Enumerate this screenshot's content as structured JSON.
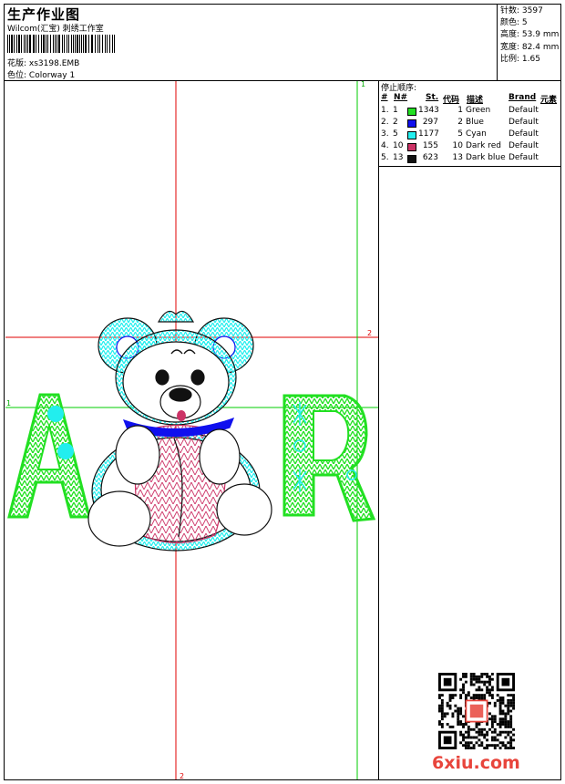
{
  "header": {
    "title": "生产作业图",
    "company": "Wilcom(汇宝) 刺绣工作室",
    "design_label": "花版:",
    "design_file": "xs3198.EMB",
    "colorway_label": "色位:",
    "colorway_name": "Colorway 1"
  },
  "stats": {
    "stitches_label": "针数:",
    "stitches": "3597",
    "colors_label": "颜色:",
    "colors": "5",
    "height_label": "高度:",
    "height": "53.9 mm",
    "width_label": "宽度:",
    "width": "82.4 mm",
    "scale_label": "比例:",
    "scale": "1.65"
  },
  "stop_sequence": {
    "title": "停止顺序:",
    "columns": [
      "#",
      "N#",
      "St.",
      "代码",
      "描述",
      "Brand",
      "元素"
    ],
    "rows": [
      {
        "num": "1.",
        "n": "1",
        "color": "#22e022",
        "stitches": "1343",
        "code": "1",
        "desc": "Green",
        "brand": "Default"
      },
      {
        "num": "2.",
        "n": "2",
        "color": "#1010ee",
        "stitches": "297",
        "code": "2",
        "desc": "Blue",
        "brand": "Default"
      },
      {
        "num": "3.",
        "n": "5",
        "color": "#22eeee",
        "stitches": "1177",
        "code": "5",
        "desc": "Cyan",
        "brand": "Default"
      },
      {
        "num": "4.",
        "n": "10",
        "color": "#cc3366",
        "stitches": "155",
        "code": "10",
        "desc": "Dark red",
        "brand": "Default"
      },
      {
        "num": "5.",
        "n": "13",
        "color": "#111111",
        "stitches": "623",
        "code": "13",
        "desc": "Dark blue",
        "brand": "Default"
      }
    ]
  },
  "guides": {
    "v_green_top": "1",
    "h_red_right": "2",
    "h_green_left": "1",
    "v_red_bottom": "2"
  },
  "watermark": "6xiu.com",
  "colors": {
    "green": "#22e022",
    "cyan": "#22eeee",
    "blue": "#1010ee",
    "darkred": "#cc3366",
    "guide_red": "#e00000",
    "guide_green": "#00cc00"
  }
}
